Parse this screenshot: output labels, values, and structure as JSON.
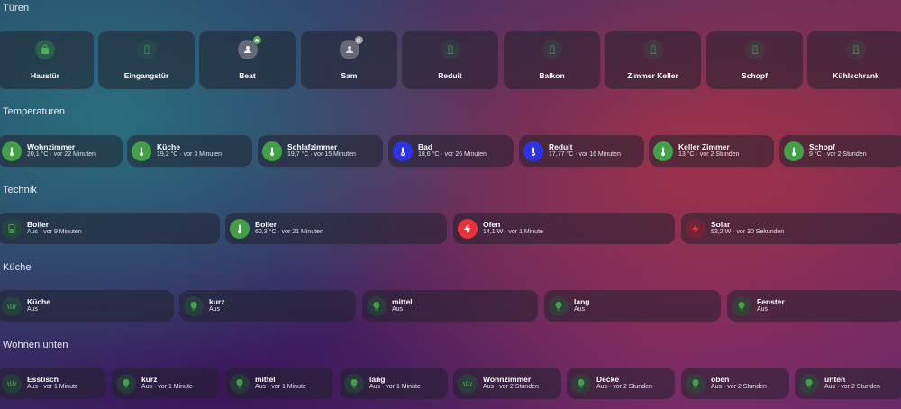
{
  "sections": {
    "tueren": "Türen",
    "temperaturen": "Temperaturen",
    "technik": "Technik",
    "kueche": "Küche",
    "wohnen_unten": "Wohnen unten"
  },
  "doors": [
    {
      "label": "Haustür",
      "icon": "lock-icon"
    },
    {
      "label": "Eingangstür",
      "icon": "door-icon"
    },
    {
      "label": "Beat",
      "icon": "person-icon",
      "badge": "home-badge-icon"
    },
    {
      "label": "Sam",
      "icon": "person-icon",
      "badge": "away-badge-icon"
    },
    {
      "label": "Reduit",
      "icon": "door-icon"
    },
    {
      "label": "Balkon",
      "icon": "door-icon"
    },
    {
      "label": "Zimmer Keller",
      "icon": "door-icon"
    },
    {
      "label": "Schopf",
      "icon": "door-icon"
    },
    {
      "label": "Kühlschrank",
      "icon": "door-icon"
    }
  ],
  "temperatures": [
    {
      "name": "Wohnzimmer",
      "state": "20,1 °C · vor 22 Minuten",
      "color": "#43a047"
    },
    {
      "name": "Küche",
      "state": "19,2 °C · vor 3 Minuten",
      "color": "#43a047"
    },
    {
      "name": "Schlafzimmer",
      "state": "19,7 °C · vor 15 Minuten",
      "color": "#43a047"
    },
    {
      "name": "Bad",
      "state": "18,6 °C · vor 26 Minuten",
      "color": "#2b33e8"
    },
    {
      "name": "Reduit",
      "state": "17,77 °C · vor 16 Minuten",
      "color": "#2b33e8"
    },
    {
      "name": "Keller Zimmer",
      "state": "13 °C · vor 2 Stunden",
      "color": "#43a047"
    },
    {
      "name": "Schopf",
      "state": "9 °C · vor 2 Stunden",
      "color": "#43a047"
    }
  ],
  "technik": [
    {
      "name": "Boiler",
      "state": "Aus · vor 9 Minuten",
      "icon": "water-boiler-icon"
    },
    {
      "name": "Boiler",
      "state": "60,3 °C · vor 21 Minuten",
      "icon": "thermometer-icon"
    },
    {
      "name": "Ofen",
      "state": "14,1 W · vor 1 Minute",
      "icon": "flash-icon"
    },
    {
      "name": "Solar",
      "state": "53,2 W · vor 30 Sekunden",
      "icon": "flash-icon"
    }
  ],
  "kueche": [
    {
      "name": "Küche",
      "state": "Aus",
      "icon": "light-group-icon"
    },
    {
      "name": "kurz",
      "state": "Aus",
      "icon": "bulb-icon"
    },
    {
      "name": "mittel",
      "state": "Aus",
      "icon": "bulb-icon"
    },
    {
      "name": "lang",
      "state": "Aus",
      "icon": "bulb-icon"
    },
    {
      "name": "Fenster",
      "state": "Aus",
      "icon": "bulb-icon"
    }
  ],
  "wohnen": [
    {
      "name": "Esstisch",
      "state": "Aus · vor 1 Minute",
      "icon": "light-group-icon"
    },
    {
      "name": "kurz",
      "state": "Aus · vor 1 Minute",
      "icon": "bulb-icon"
    },
    {
      "name": "mittel",
      "state": "Aus · vor 1 Minute",
      "icon": "bulb-icon"
    },
    {
      "name": "lang",
      "state": "Aus · vor 1 Minute",
      "icon": "bulb-icon"
    },
    {
      "name": "Wohnzimmer",
      "state": "Aus · vor 2 Stunden",
      "icon": "light-group-icon"
    },
    {
      "name": "Decke",
      "state": "Aus · vor 2 Stunden",
      "icon": "bulb-icon"
    },
    {
      "name": "oben",
      "state": "Aus · vor 2 Stunden",
      "icon": "bulb-icon"
    },
    {
      "name": "unten",
      "state": "Aus · vor 2 Stunden",
      "icon": "bulb-icon"
    }
  ]
}
